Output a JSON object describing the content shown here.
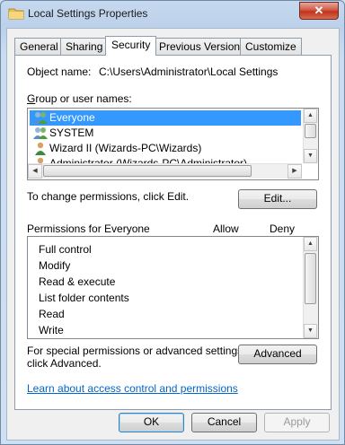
{
  "window": {
    "title": "Local Settings Properties",
    "close_glyph": "✕"
  },
  "tabs": [
    "General",
    "Sharing",
    "Security",
    "Previous Versions",
    "Customize"
  ],
  "active_tab": "Security",
  "object": {
    "label": "Object name:",
    "value": "C:\\Users\\Administrator\\Local Settings"
  },
  "groups": {
    "label": "Group or user names:",
    "items": [
      {
        "name": "Everyone",
        "icon": "group-icon",
        "selected": true
      },
      {
        "name": "SYSTEM",
        "icon": "group-icon",
        "selected": false
      },
      {
        "name": "Wizard II (Wizards-PC\\Wizards)",
        "icon": "user-icon",
        "selected": false
      },
      {
        "name": "Administrator (Wizards-PC\\Administrator)",
        "icon": "user-icon",
        "selected": false
      }
    ]
  },
  "edit": {
    "hint": "To change permissions, click Edit.",
    "button": "Edit..."
  },
  "permissions": {
    "label": "Permissions for Everyone",
    "allow_header": "Allow",
    "deny_header": "Deny",
    "items": [
      "Full control",
      "Modify",
      "Read & execute",
      "List folder contents",
      "Read",
      "Write"
    ]
  },
  "advanced": {
    "hint_line1": "For special permissions or advanced settings,",
    "hint_line2": "click Advanced.",
    "button": "Advanced"
  },
  "link": "Learn about access control and permissions",
  "buttons": {
    "ok": "OK",
    "cancel": "Cancel",
    "apply": "Apply"
  },
  "colors": {
    "selection": "#3399ff",
    "link": "#0066cc",
    "close_button": "#c2341e"
  }
}
